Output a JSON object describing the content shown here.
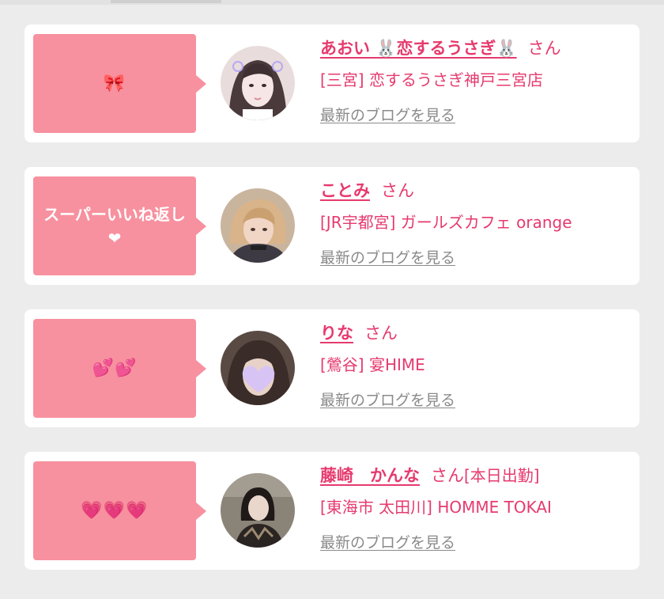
{
  "colors": {
    "accent": "#e63a6e",
    "bubble": "#f7919f",
    "card": "#ffffff",
    "background": "#ececec",
    "link_gray": "#8a8a8a"
  },
  "honorific": "さん",
  "blog_link_label": "最新のブログを見る",
  "cards": [
    {
      "bubble_text": "🎀",
      "name": "あおい 🐰恋するうさぎ🐰",
      "status": "",
      "shop": "[三宮] 恋するうさぎ神戸三宮店",
      "avatar_icon": "girl-photo-icon"
    },
    {
      "bubble_text": "スーパーいいね返し ❤",
      "name": "ことみ",
      "status": "",
      "shop": "[JR宇都宮] ガールズカフェ orange",
      "avatar_icon": "girl-photo-icon"
    },
    {
      "bubble_text": "💕💕",
      "name": "りな",
      "status": "",
      "shop": "[鶯谷] 宴HIME",
      "avatar_icon": "girl-photo-icon"
    },
    {
      "bubble_text": "💗💗💗",
      "name": "藤崎　かんな",
      "status": "[本日出勤]",
      "shop": "[東海市 太田川] HOMME TOKAI",
      "avatar_icon": "girl-photo-icon"
    }
  ]
}
